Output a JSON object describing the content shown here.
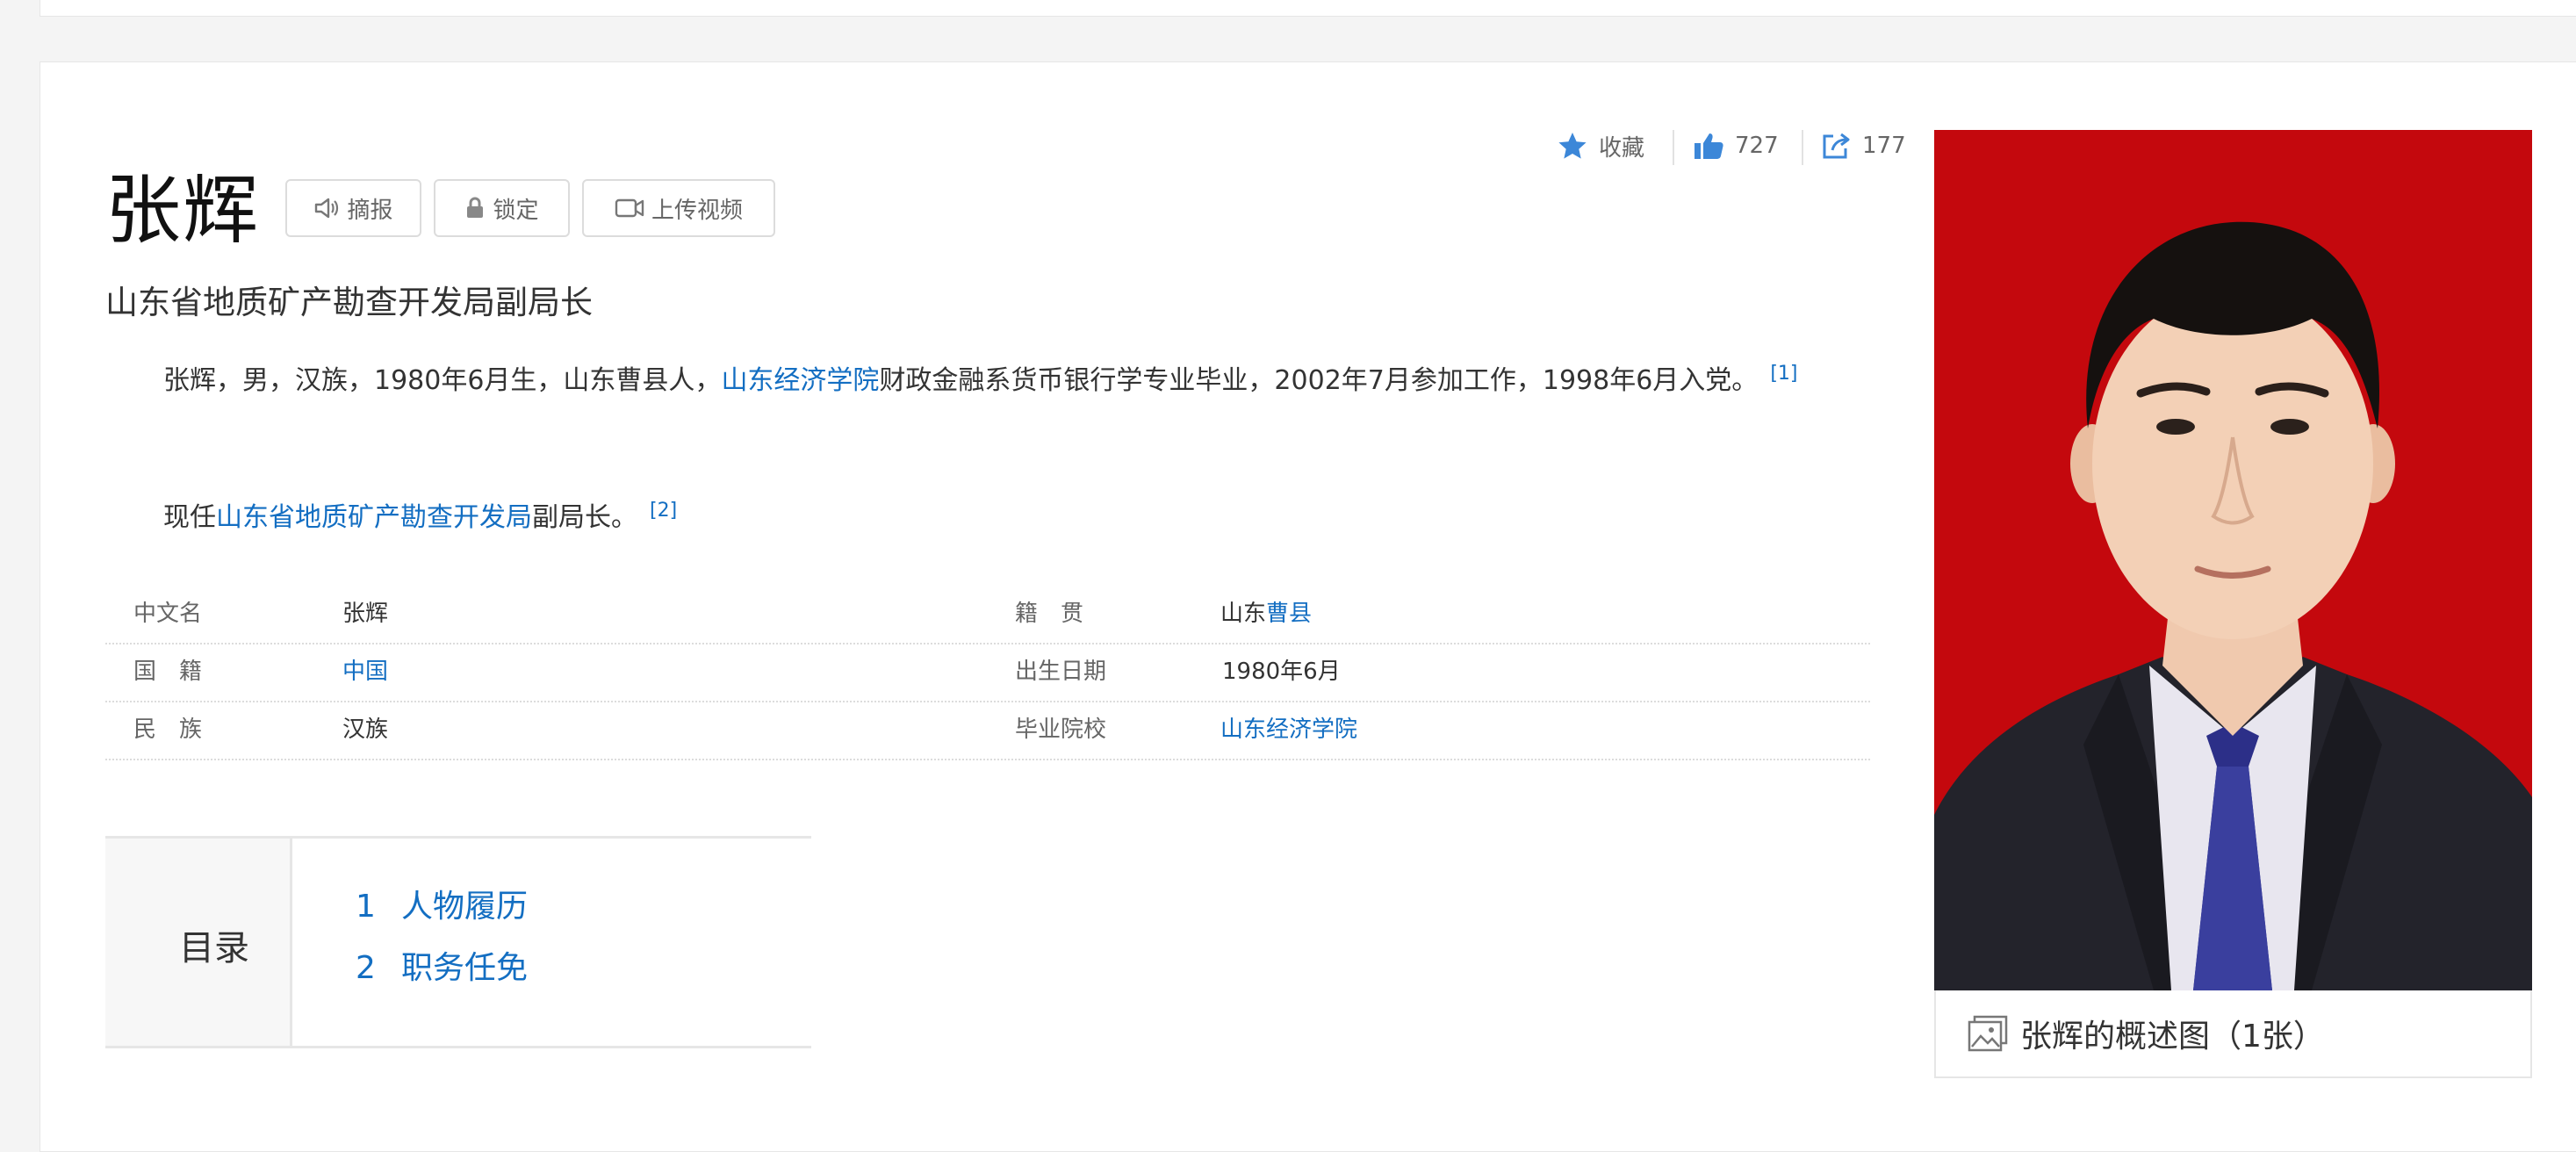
{
  "header": {
    "title": "张辉",
    "buttons": {
      "report": "摘报",
      "lock": "锁定",
      "upload_video": "上传视频"
    }
  },
  "actions": {
    "favorite_label": "收藏",
    "like_count": "727",
    "share_count": "177"
  },
  "subtitle": "山东省地质矿产勘查开发局副局长",
  "summary": {
    "p1_before": "张辉，男，汉族，1980年6月生，山东曹县人，",
    "p1_link": "山东经济学院",
    "p1_after": "财政金融系货币银行学专业毕业，2002年7月参加工作，1998年6月入党。",
    "p1_ref": "[1]",
    "p2_before": "现任",
    "p2_link": "山东省地质矿产勘查开发局",
    "p2_after": "副局长。",
    "p2_ref": "[2]"
  },
  "info": {
    "rows": [
      {
        "l1": "中文名",
        "v1": "张辉",
        "l2": "籍　贯",
        "v2_plain": "山东",
        "v2_link": "曹县"
      },
      {
        "l1": "国　籍",
        "v1": "中国",
        "l2": "出生日期",
        "v2_plain": "1980年6月",
        "v2_link": ""
      },
      {
        "l1": "民　族",
        "v1": "汉族",
        "l2": "毕业院校",
        "v2_plain": "",
        "v2_link": "山东经济学院"
      }
    ]
  },
  "toc": {
    "title": "目录",
    "items": [
      {
        "num": "1",
        "label": "人物履历"
      },
      {
        "num": "2",
        "label": "职务任免"
      }
    ]
  },
  "photo": {
    "caption": "张辉的概述图（1张）"
  },
  "colors": {
    "link": "#136ec2",
    "photo_background": "#c4080d",
    "icon_accent": "#3c87d8"
  }
}
